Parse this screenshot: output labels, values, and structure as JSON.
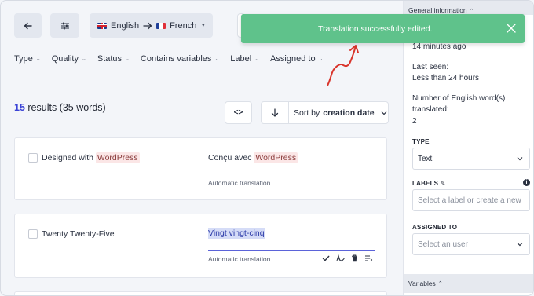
{
  "toolbar": {
    "back_icon": "arrow-left-icon",
    "filter_icon": "sliders-icon",
    "source_language": "English",
    "target_language": "French",
    "arrow_icon": "arrow-right-icon"
  },
  "filters": [
    {
      "label": "Type"
    },
    {
      "label": "Quality"
    },
    {
      "label": "Status"
    },
    {
      "label": "Contains variables"
    },
    {
      "label": "Label"
    },
    {
      "label": "Assigned to"
    }
  ],
  "results": {
    "count": "15",
    "rest": " results (35 words)"
  },
  "sort": {
    "prefix": "Sort by",
    "value": "creation date",
    "code_icon": "code-brackets-icon",
    "direction_icon": "arrow-down-icon"
  },
  "rows": [
    {
      "source_prefix": "Designed with",
      "source_highlight": "WordPress",
      "target_prefix": "Conçu avec",
      "target_highlight": "WordPress",
      "status": "Automatic translation"
    },
    {
      "source": "Twenty Twenty-Five",
      "target": "Vingt vingt-cinq",
      "status": "Automatic translation",
      "actions": [
        "check-icon",
        "spellcheck-icon",
        "trash-icon",
        "list-icon"
      ]
    }
  ],
  "toast": {
    "message": "Translation successfully edited.",
    "color": "#5fc28b"
  },
  "sidebar": {
    "general_header": "General information",
    "created_value": "14 minutes ago",
    "last_seen_label": "Last seen:",
    "last_seen_value": "Less than 24 hours",
    "words_label_1": "Number of English word(s)",
    "words_label_2": "translated:",
    "words_value": "2",
    "type_label": "TYPE",
    "type_value": "Text",
    "labels_label": "LABELS",
    "labels_placeholder": "Select a label or create a new",
    "assigned_label": "ASSIGNED TO",
    "assigned_placeholder": "Select an user",
    "variables_header": "Variables"
  },
  "colors": {
    "accent": "#3b43d6",
    "highlight_bg": "#fbe6e6",
    "annotation": "#d9342b"
  }
}
